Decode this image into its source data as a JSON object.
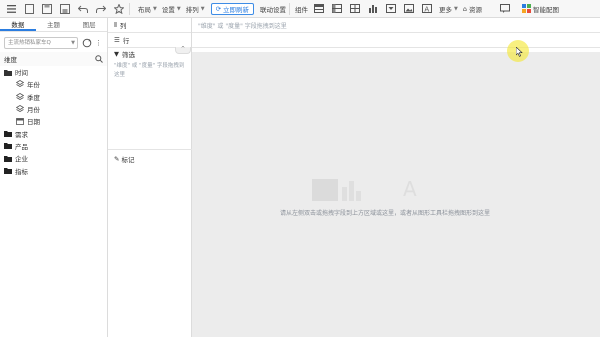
{
  "toolbar": {
    "menus": [
      "布局",
      "设置",
      "排列"
    ],
    "refresh_label": "立即刷新",
    "link_settings": "联动设置",
    "component_label": "组件",
    "more_label": "更多",
    "resource_label": "资源",
    "smart_layout_label": "智能配图"
  },
  "left_panel": {
    "tabs": [
      "数据",
      "主题",
      "图层"
    ],
    "search_placeholder": "主流热销私家车Q",
    "dimension_header": "维度",
    "tree": [
      {
        "label": "时间",
        "icon": "folder-open-icon",
        "level": 0
      },
      {
        "label": "年份",
        "icon": "hierarchy-icon",
        "level": 1
      },
      {
        "label": "季度",
        "icon": "hierarchy-icon",
        "level": 1
      },
      {
        "label": "月份",
        "icon": "hierarchy-icon",
        "level": 1
      },
      {
        "label": "日期",
        "icon": "calendar-icon",
        "level": 1
      },
      {
        "label": "需求",
        "icon": "folder-icon",
        "level": 0
      },
      {
        "label": "产品",
        "icon": "folder-icon",
        "level": 0
      },
      {
        "label": "企业",
        "icon": "folder-icon",
        "level": 0
      },
      {
        "label": "指标",
        "icon": "folder-icon",
        "level": 0
      }
    ]
  },
  "middle": {
    "column_label": "列",
    "row_label": "行",
    "filter_label": "筛选",
    "filter_hint": "\"维度\" 或 \"度量\" 字段拖拽到这里",
    "mark_label": "标记"
  },
  "shelves": {
    "column_hint": "\"维度\" 或 \"度量\" 字段拖拽到这里",
    "row_hint": ""
  },
  "canvas": {
    "hint": "请从左侧双击或拖拽字段到上方区域或这里，或者从图形工具栏拖拽图形到这里",
    "ghost_letter": "A"
  },
  "colors": {
    "accent": "#2b7de0",
    "canvas_bg": "#ececec",
    "cursor_highlight": "#f5e83c"
  }
}
